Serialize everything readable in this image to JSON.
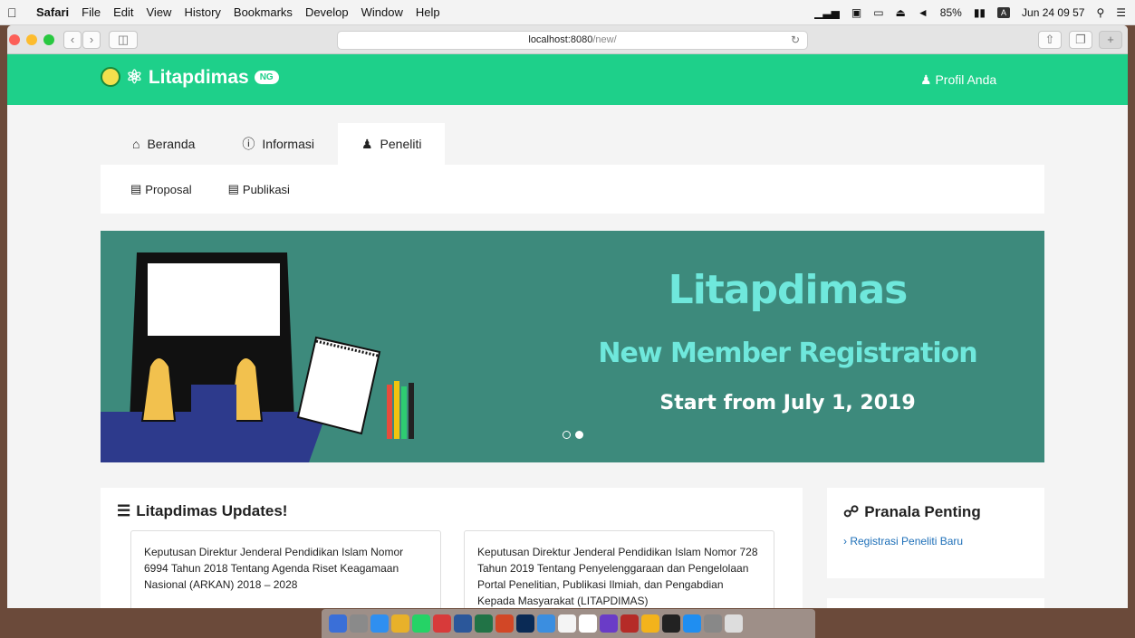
{
  "menubar": {
    "app": "Safari",
    "items": [
      "File",
      "Edit",
      "View",
      "History",
      "Bookmarks",
      "Develop",
      "Window",
      "Help"
    ],
    "battery": "85%",
    "input": "A",
    "clock": "Jun 24  09 57"
  },
  "browser": {
    "url_host": "localhost:8080",
    "url_path": "/new/"
  },
  "navbar": {
    "brand": "Litapdimas",
    "badge": "NG",
    "profile": "Profil Anda"
  },
  "tabs": [
    {
      "label": "Beranda",
      "icon": "home-icon"
    },
    {
      "label": "Informasi",
      "icon": "info-icon"
    },
    {
      "label": "Peneliti",
      "icon": "user-icon"
    }
  ],
  "subnav": [
    {
      "label": "Proposal",
      "icon": "file-icon"
    },
    {
      "label": "Publikasi",
      "icon": "newspaper-icon"
    }
  ],
  "banner": {
    "title": "Litapdimas",
    "subtitle": "New Member Registration",
    "tagline": "Start from July 1, 2019",
    "slide_count": 2,
    "active_slide": 2
  },
  "updates": {
    "title": "Litapdimas Updates!",
    "cards": [
      {
        "text": "Keputusan Direktur Jenderal Pendidikan Islam Nomor 6994 Tahun 2018 Tentang Agenda Riset Keagamaan Nasional (ARKAN) 2018 – 2028"
      },
      {
        "text": "Keputusan Direktur Jenderal Pendidikan Islam Nomor 728 Tahun 2019 Tentang Penyelenggaraan dan Pengelolaan Portal Penelitian, Publikasi Ilmiah, dan Pengabdian Kepada Masyarakat (LITAPDIMAS)"
      }
    ]
  },
  "pranala": {
    "title": "Pranala Penting",
    "links": [
      "Registrasi Peneliti Baru"
    ]
  },
  "colors": {
    "navbar": "#1ed08a",
    "banner": "#3d8a7c",
    "banner_text": "#6fe8dc"
  }
}
